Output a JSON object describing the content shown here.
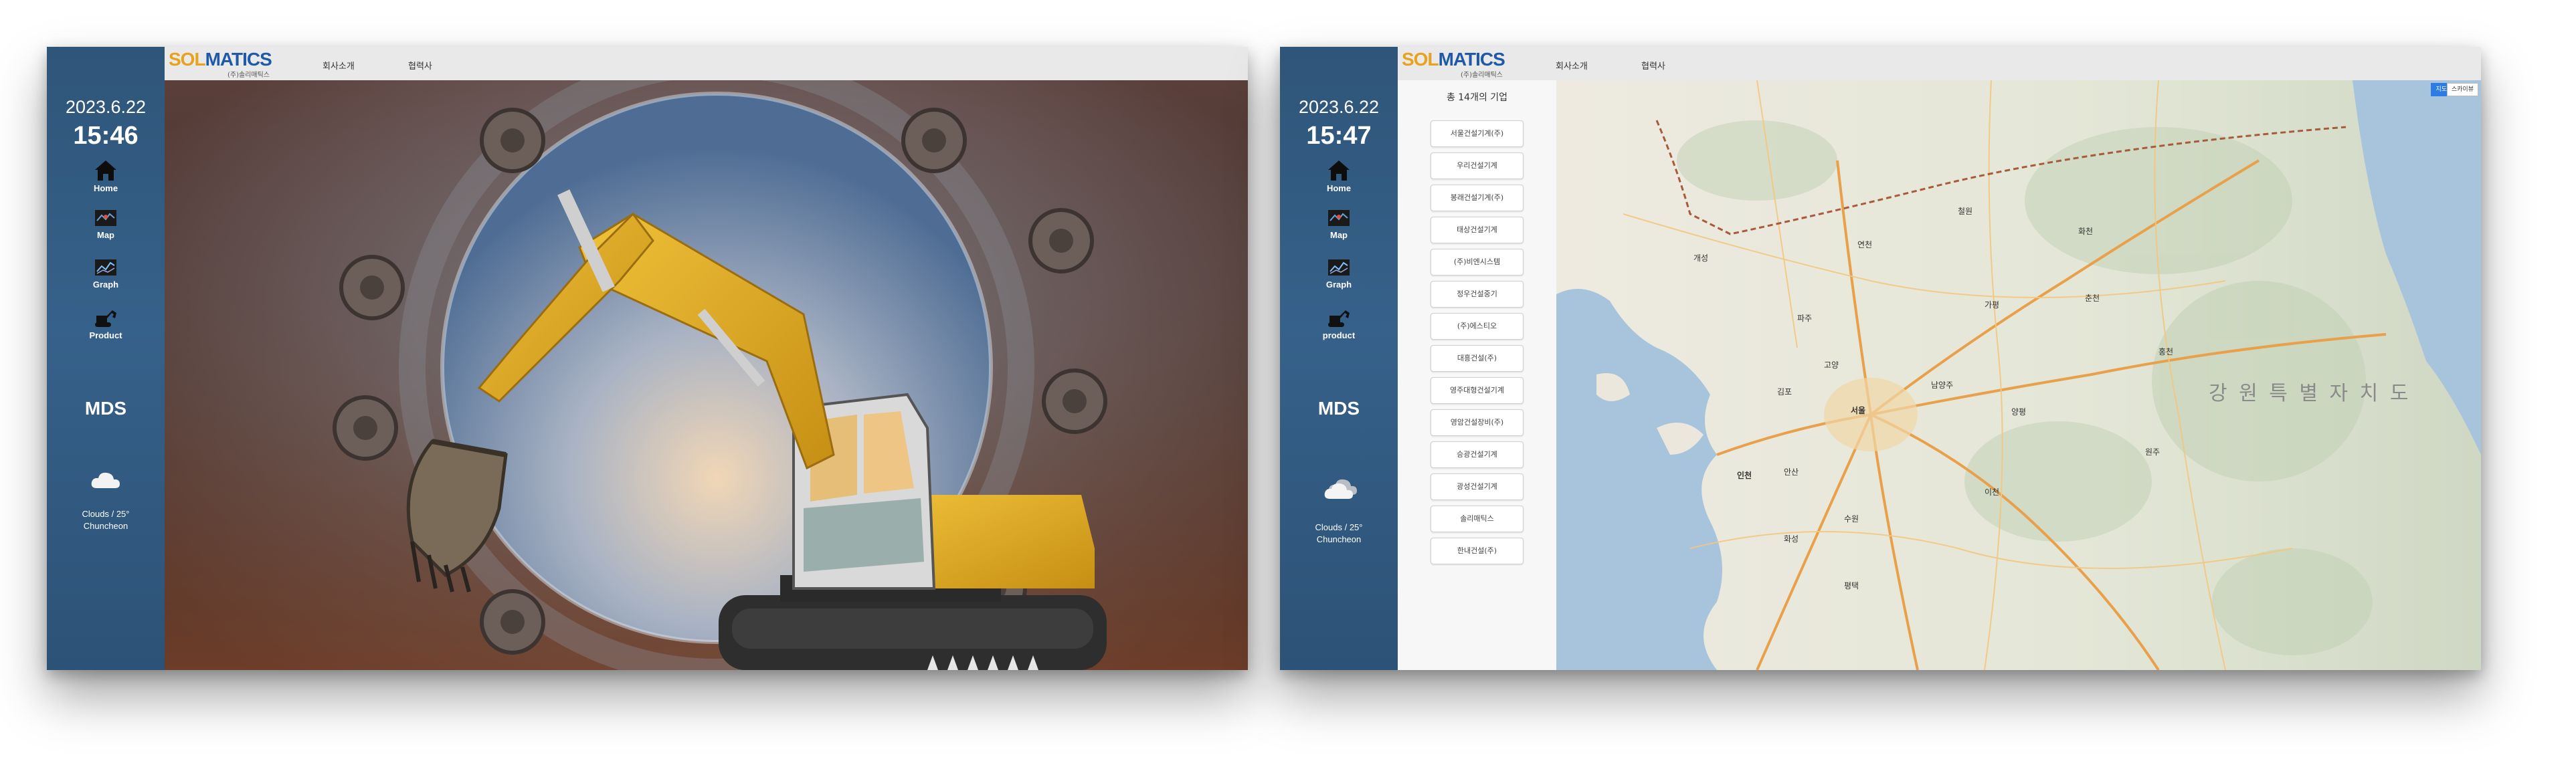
{
  "brand": {
    "sol": "SOL",
    "matics": "MATICS",
    "subtitle": "(주)솔리매틱스"
  },
  "top_menu": {
    "about": "회사소개",
    "partners": "협력사"
  },
  "nav": {
    "home": "Home",
    "map": "Map",
    "graph": "Graph",
    "product_a": "Product",
    "product_b": "product"
  },
  "icons": [
    "home-icon",
    "map-icon",
    "graph-icon",
    "excavator-icon",
    "cloud-icon"
  ],
  "screen_a": {
    "date": "2023.6.22",
    "time": "15:46",
    "title": "MDS",
    "weather_line1": "Clouds / 25°",
    "weather_line2": "Chuncheon"
  },
  "screen_b": {
    "date": "2023.6.22",
    "time": "15:47",
    "title": "MDS",
    "weather_line1": "Clouds / 25°",
    "weather_line2": "Chuncheon"
  },
  "company_panel": {
    "title": "총 14개의 기업",
    "companies": [
      "서울건설기계(주)",
      "우리건설기계",
      "봉래건설기계(주)",
      "태상건설기계",
      "(주)비엔시스템",
      "정우건설중기",
      "(주)에스티오",
      "대흥건설(주)",
      "영주대형건설기계",
      "영암건설장비(주)",
      "승광건설기계",
      "광성건설기계",
      "솔리매틱스",
      "한내건설(주)"
    ]
  },
  "map": {
    "btn_map": "지도",
    "btn_satellite": "스카이뷰",
    "region_label": "강 원 특 별 자 치 도",
    "labels": [
      "개성",
      "서울",
      "인천",
      "수원",
      "남양주",
      "양평",
      "가평",
      "춘천",
      "홍천",
      "원주",
      "이천",
      "평택",
      "화성",
      "안산",
      "김포",
      "고양",
      "파주",
      "연천",
      "철원",
      "화천"
    ]
  },
  "colors": {
    "sidebar": "#33608a",
    "accent": "#1e5aa8",
    "brand_orange": "#e8a21d"
  }
}
